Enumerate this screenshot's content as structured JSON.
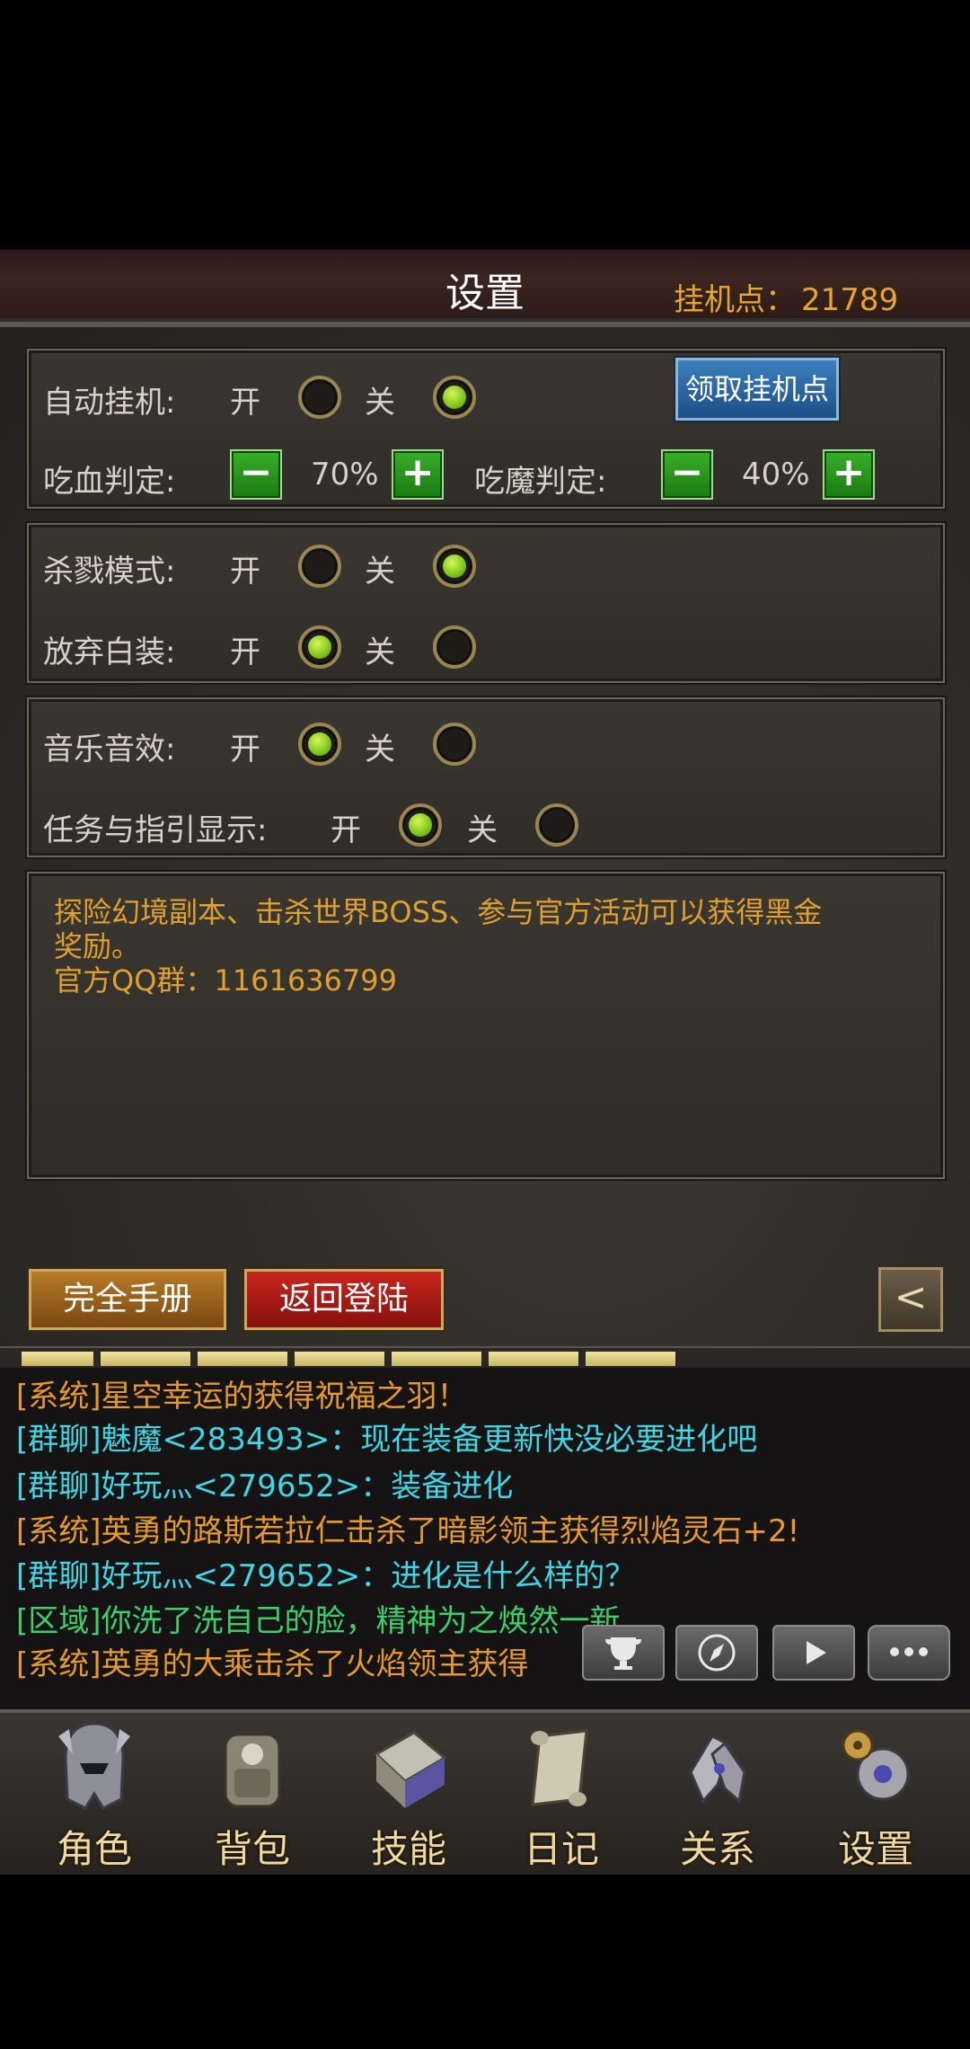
{
  "header": {
    "title": "设置",
    "points_label": "挂机点：",
    "points_value": "21789"
  },
  "panel_auto": {
    "auto_label": "自动挂机:",
    "on": "开",
    "off": "关",
    "auto_state": "off",
    "claim_button": "领取挂机点",
    "hp_label": "吃血判定:",
    "hp_value": "70%",
    "mp_label": "吃魔判定:",
    "mp_value": "40%",
    "minus": "−",
    "plus": "+"
  },
  "panel_combat": {
    "kill_label": "杀戮模式:",
    "kill_state": "off",
    "drop_label": "放弃白装:",
    "drop_state": "on",
    "on": "开",
    "off": "关"
  },
  "panel_audio": {
    "music_label": "音乐音效:",
    "music_state": "on",
    "guide_label": "任务与指引显示:",
    "guide_state": "on",
    "on": "开",
    "off": "关"
  },
  "notice": {
    "line1": "探险幻境副本、击杀世界BOSS、参与官方活动可以获得黑金",
    "line2": "奖励。",
    "line3": "官方QQ群：1161636799"
  },
  "buttons": {
    "manual": "完全手册",
    "relogin": "返回登陆",
    "back": "<"
  },
  "chat": [
    {
      "type": "sys",
      "text": "[系统]星空幸运的获得祝福之羽！"
    },
    {
      "type": "grp",
      "text": "[群聊]魅魔<283493>：现在装备更新快没必要进化吧"
    },
    {
      "type": "grp",
      "text": "[群聊]好玩灬<279652>：装备进化"
    },
    {
      "type": "sys",
      "text": "[系统]英勇的路斯若拉仁击杀了暗影领主获得烈焰灵石+2!"
    },
    {
      "type": "grp",
      "text": "[群聊]好玩灬<279652>：进化是什么样的？"
    },
    {
      "type": "reg",
      "text": "[区域]你洗了洗自己的脸，精神为之焕然一新..."
    },
    {
      "type": "sys",
      "text": "[系统]英勇的大乘击杀了火焰领主获得"
    }
  ],
  "nav": [
    "角色",
    "背包",
    "技能",
    "日记",
    "关系",
    "设置"
  ],
  "colors": {
    "accent": "#e6a52e",
    "system_chat": "#e69a2a",
    "group_chat": "#3ed6e4",
    "region_chat": "#3ad06c"
  }
}
